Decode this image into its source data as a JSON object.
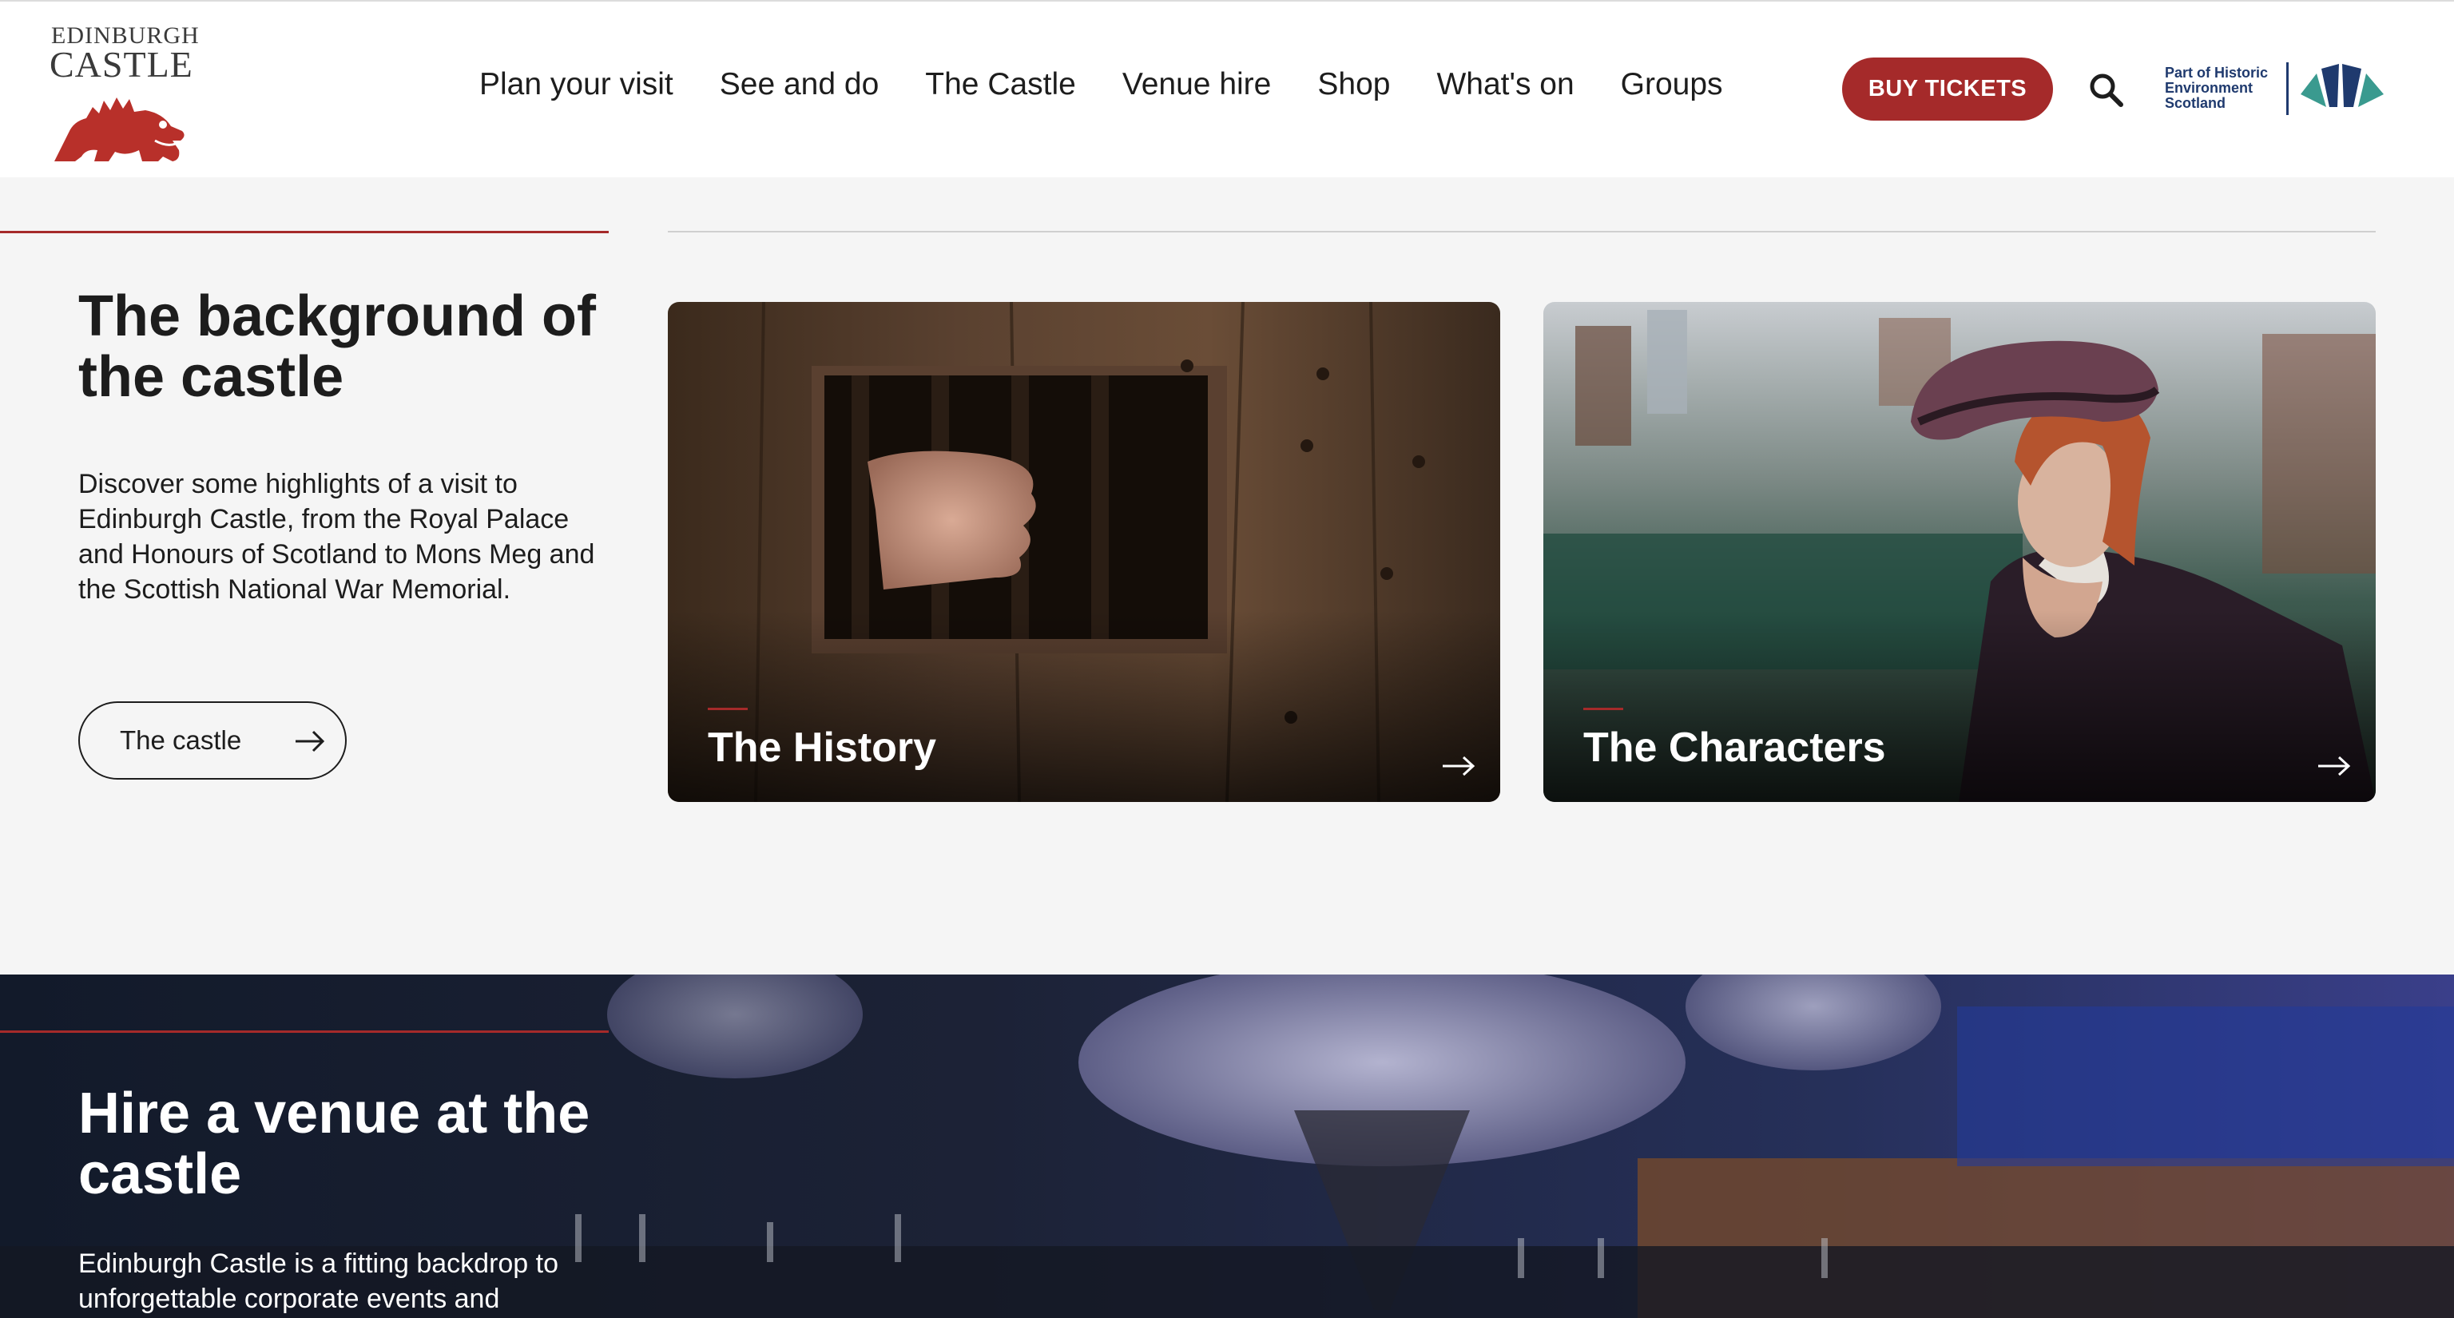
{
  "header": {
    "logo": {
      "line1": "EDINBURGH",
      "line2": "CASTLE",
      "icon": "lion-icon"
    },
    "nav": [
      {
        "label": "Plan your visit"
      },
      {
        "label": "See and do"
      },
      {
        "label": "The Castle"
      },
      {
        "label": "Venue hire"
      },
      {
        "label": "Shop"
      },
      {
        "label": "What's on"
      },
      {
        "label": "Groups"
      }
    ],
    "buy_tickets": "BUY TICKETS",
    "search_icon": "search-icon",
    "partner": {
      "text": "Part of Historic Environment Scotland",
      "icon": "hes-logo-icon"
    }
  },
  "background_section": {
    "title": "The background of the castle",
    "description": "Discover some highlights of a visit to Edinburgh Castle, from the Royal Palace and Honours of Scotland to Mons Meg and the Scottish National War Memorial.",
    "button": "The castle",
    "cards": [
      {
        "title": "The History",
        "icon": "arrow-right-icon"
      },
      {
        "title": "The Characters",
        "icon": "arrow-right-icon"
      }
    ]
  },
  "venue_section": {
    "title": "Hire a venue at the castle",
    "description": "Edinburgh Castle is a fitting backdrop to unforgettable corporate events and"
  },
  "colors": {
    "accent": "#a52a2a",
    "background": "#f5f5f5",
    "header_bg": "#ffffff",
    "partner_blue": "#1f3a6e",
    "partner_teal": "#3a9a8f"
  }
}
